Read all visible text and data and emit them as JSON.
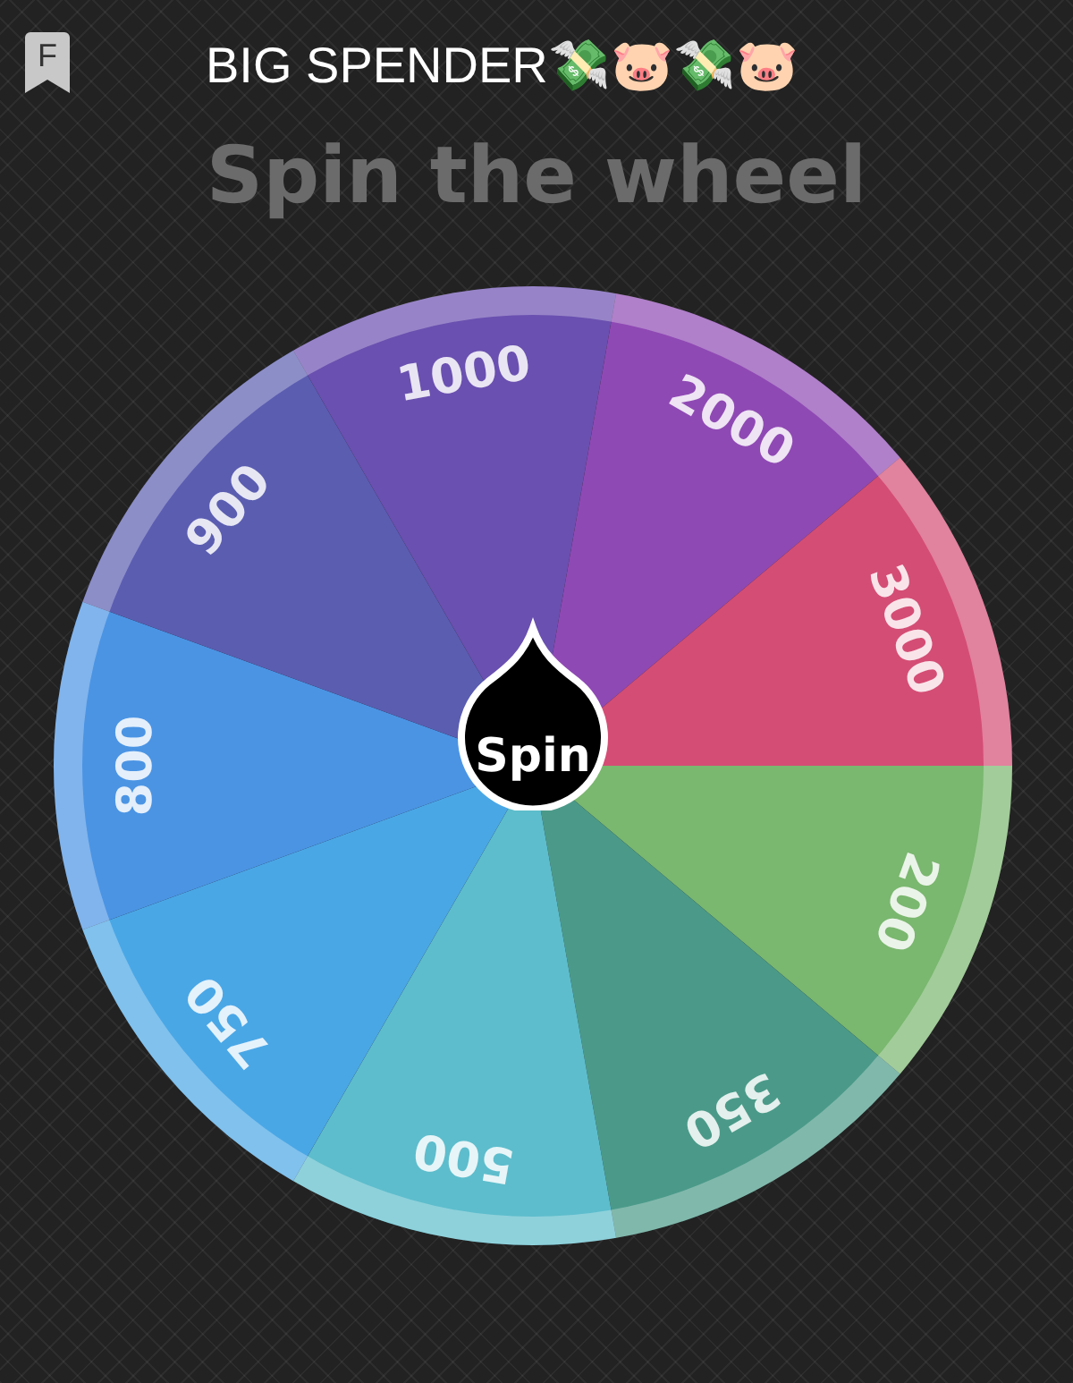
{
  "header": {
    "bookmark_letter": "F",
    "title": "BIG SPENDER💸🐷💸🐷"
  },
  "heading": "Spin the wheel",
  "wheel": {
    "segments": [
      {
        "label": "200",
        "color": "#7ab76f"
      },
      {
        "label": "350",
        "color": "#4b9a89"
      },
      {
        "label": "500",
        "color": "#5dbdcc"
      },
      {
        "label": "750",
        "color": "#4aa7e6"
      },
      {
        "label": "800",
        "color": "#4b94e4"
      },
      {
        "label": "900",
        "color": "#5b5db1"
      },
      {
        "label": "1000",
        "color": "#6a50b0"
      },
      {
        "label": "2000",
        "color": "#8f49b4"
      },
      {
        "label": "3000",
        "color": "#d44d75"
      }
    ],
    "spin_button": "Spin"
  }
}
